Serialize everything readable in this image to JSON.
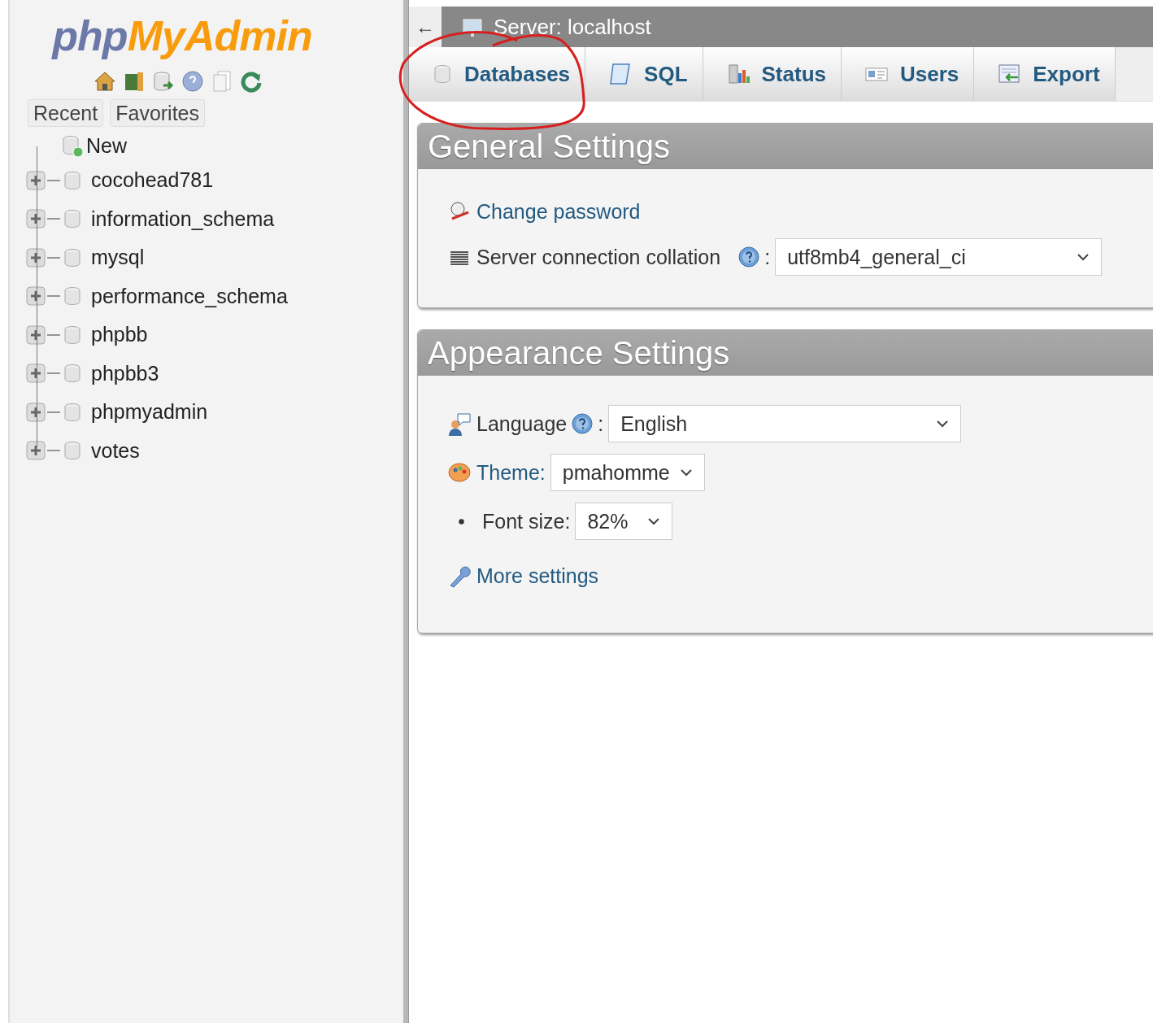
{
  "logo": {
    "part_1": "php",
    "part_2": "MyAdmin"
  },
  "sidebar_tabs": [
    {
      "label": "Recent"
    },
    {
      "label": "Favorites"
    }
  ],
  "tree": {
    "new_item": "New",
    "databases": [
      {
        "name": "cocohead781",
        "expanded": false
      },
      {
        "name": "information_schema",
        "expanded": false
      },
      {
        "name": "mysql",
        "expanded": false
      },
      {
        "name": "performance_schema",
        "expanded": false
      },
      {
        "name": "phpbb",
        "expanded": false
      },
      {
        "name": "phpbb3",
        "expanded": false
      },
      {
        "name": "phpmyadmin",
        "expanded": false
      },
      {
        "name": "votes",
        "expanded": false
      }
    ]
  },
  "breadcrumb": {
    "back": "←",
    "server": "Server: localhost"
  },
  "tabs": [
    {
      "label": "Databases",
      "kind": "database"
    },
    {
      "label": "SQL",
      "kind": "sql"
    },
    {
      "label": "Status",
      "kind": "status"
    },
    {
      "label": "Users",
      "kind": "users"
    },
    {
      "label": "Export",
      "kind": "export"
    }
  ],
  "general_settings": {
    "title": "General Settings",
    "change_password": "Change password",
    "collation": {
      "label": "Server connection collation",
      "separator": ":",
      "value": "utf8mb4_general_ci"
    }
  },
  "appearance_settings": {
    "title": "Appearance Settings",
    "language": {
      "label": "Language",
      "separator": ":",
      "value": "English"
    },
    "theme": {
      "label": "Theme:",
      "value": "pmahomme"
    },
    "font_size": {
      "label": "Font size:",
      "value": "82%"
    },
    "more_settings": "More settings"
  },
  "annotation": {
    "kind": "hand-drawn-circle"
  }
}
